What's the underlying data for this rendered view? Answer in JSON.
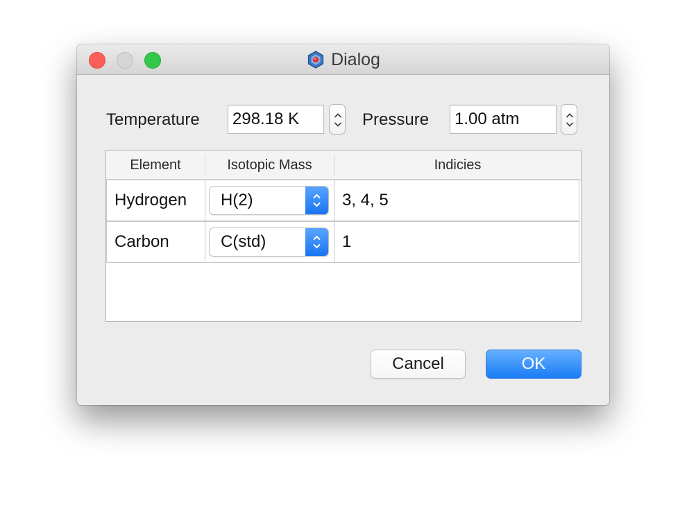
{
  "window": {
    "title": "Dialog"
  },
  "conditions": {
    "temperature_label": "Temperature",
    "temperature_value": "298.18 K",
    "pressure_label": "Pressure",
    "pressure_value": "1.00 atm"
  },
  "table": {
    "headers": [
      "Element",
      "Isotopic Mass",
      "Indicies"
    ],
    "rows": [
      {
        "element": "Hydrogen",
        "isotopic_mass": "H(2)",
        "indices": "3, 4, 5"
      },
      {
        "element": "Carbon",
        "isotopic_mass": "C(std)",
        "indices": "1"
      }
    ]
  },
  "buttons": {
    "cancel": "Cancel",
    "ok": "OK"
  },
  "colors": {
    "accent": "#1a7cf5",
    "close": "#fc5f57",
    "maximize": "#34c84a"
  }
}
